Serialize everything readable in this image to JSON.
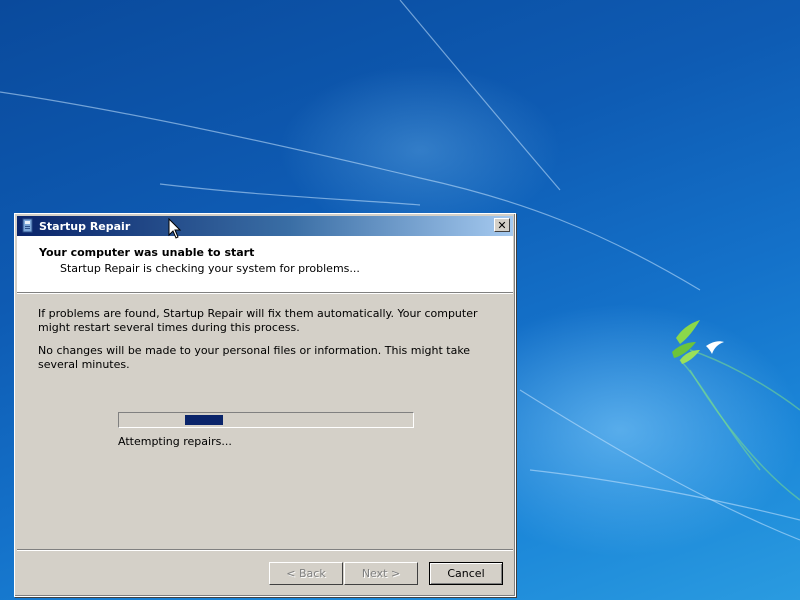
{
  "window": {
    "title": "Startup Repair",
    "close_glyph": "✕"
  },
  "header": {
    "title": "Your computer was unable to start",
    "subtitle": "Startup Repair is checking your system for problems..."
  },
  "body": {
    "paragraph1": "If problems are found, Startup Repair will fix them automatically. Your computer might restart several times during this process.",
    "paragraph2": "No changes will be made to your personal files or information. This might take several minutes."
  },
  "progress": {
    "status": "Attempting repairs...",
    "indeterminate": true,
    "chunk_color": "#0a246a"
  },
  "buttons": {
    "back": "< Back",
    "next": "Next >",
    "cancel": "Cancel"
  },
  "colors": {
    "titlebar_start": "#0a246a",
    "titlebar_end": "#a6caf0",
    "dialog_face": "#d4d0c8",
    "desktop_blue": "#1471c9"
  },
  "icons": {
    "title_icon": "startup-repair-icon",
    "cursor": "mouse-pointer-icon",
    "wallpaper_logo": "bird-leaves-logo"
  }
}
